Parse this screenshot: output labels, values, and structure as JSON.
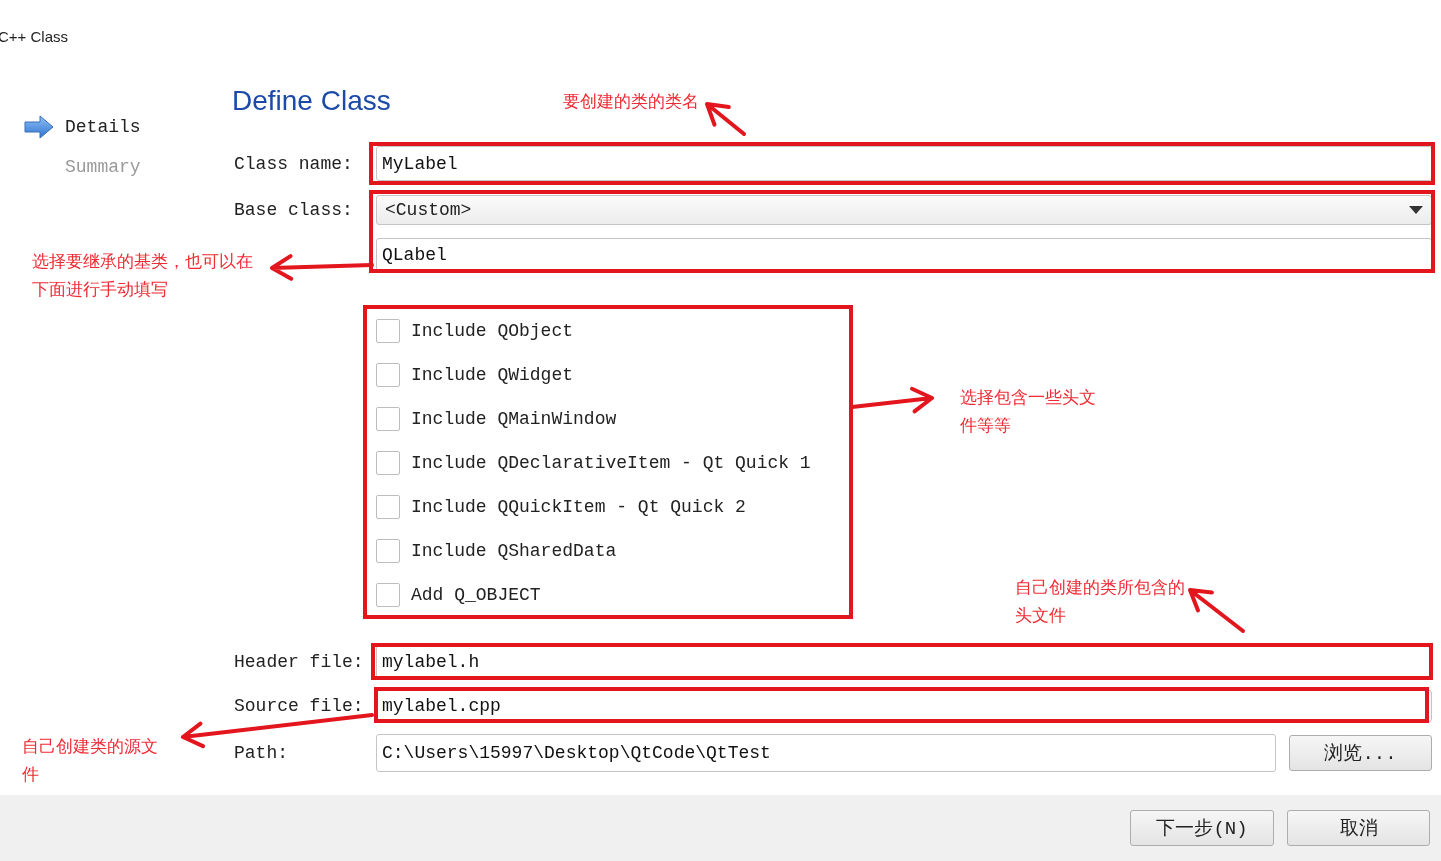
{
  "window": {
    "title": "C++ Class"
  },
  "steps": [
    {
      "label": "Details",
      "selected": true
    },
    {
      "label": "Summary",
      "selected": false
    }
  ],
  "page_title": "Define Class",
  "form": {
    "class_name": {
      "label": "Class name:",
      "value": "MyLabel"
    },
    "base_class": {
      "label": "Base class:",
      "value": "<Custom>",
      "custom_value": "QLabel"
    },
    "includes": [
      {
        "label": "Include QObject",
        "checked": false
      },
      {
        "label": "Include QWidget",
        "checked": false
      },
      {
        "label": "Include QMainWindow",
        "checked": false
      },
      {
        "label": "Include QDeclarativeItem - Qt Quick 1",
        "checked": false
      },
      {
        "label": "Include QQuickItem - Qt Quick 2",
        "checked": false
      },
      {
        "label": "Include QSharedData",
        "checked": false
      },
      {
        "label": "Add Q_OBJECT",
        "checked": false
      }
    ],
    "header_file": {
      "label": "Header file:",
      "value": "mylabel.h"
    },
    "source_file": {
      "label": "Source file:",
      "value": "mylabel.cpp"
    },
    "path": {
      "label": "Path:",
      "value": "C:\\Users\\15997\\Desktop\\QtCode\\QtTest",
      "browse_button": "浏览..."
    }
  },
  "buttons": [
    {
      "label": "下一步(N)"
    },
    {
      "label": "取消"
    }
  ],
  "annotations": [
    {
      "text": "要创建的类的类名"
    },
    {
      "text": "选择要继承的基类，也可以在下面进行手动填写"
    },
    {
      "text": "选择包含一些头文件等等"
    },
    {
      "text": "自己创建的类所包含的头文件"
    },
    {
      "text": "自己创建类的源文件"
    }
  ]
}
